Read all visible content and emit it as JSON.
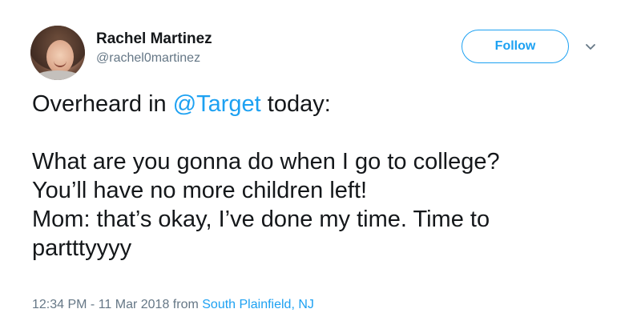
{
  "author": {
    "name": "Rachel Martinez",
    "handle": "@rachel0martinez"
  },
  "actions": {
    "follow_label": "Follow"
  },
  "tweet": {
    "line1_prefix": "Overheard in ",
    "mention": "@Target",
    "line1_suffix": " today:",
    "line2": "What are you gonna do when I go to college?",
    "line3": "You’ll have no more children left!",
    "line4": "Mom: that’s okay, I’ve done my time. Time to",
    "line5": "partttyyyy"
  },
  "meta": {
    "timestamp": "12:34 PM - 11 Mar 2018",
    "from_label": " from ",
    "location": "South Plainfield, NJ"
  },
  "colors": {
    "accent": "#1da1f2",
    "text": "#14171a",
    "muted": "#657786"
  }
}
